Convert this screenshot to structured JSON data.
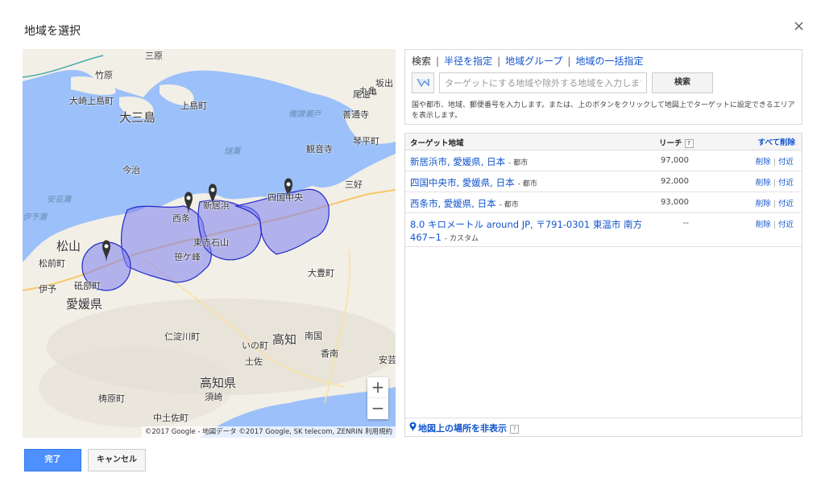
{
  "dialog": {
    "title": "地域を選択",
    "close": "×"
  },
  "tabs": {
    "search": "検索",
    "radius": "半径を指定",
    "group": "地域グループ",
    "bulk": "地域の一括指定"
  },
  "search": {
    "placeholder": "ターゲットにする地域や除外する地域を入力します",
    "button": "検索",
    "hint": "国や都市、地域、郵便番号を入力します。または、上のボタンをクリックして地図上でターゲットに設定できるエリアを表示します。"
  },
  "list": {
    "col_location": "ターゲット地域",
    "col_reach": "リーチ",
    "help": "?",
    "remove_all": "すべて削除",
    "rows": [
      {
        "name": "新居浜市, 愛媛県, 日本",
        "kind": "- 都市",
        "reach": "97,000",
        "remove": "削除",
        "nearby": "付近"
      },
      {
        "name": "四国中央市, 愛媛県, 日本",
        "kind": "- 都市",
        "reach": "92,000",
        "remove": "削除",
        "nearby": "付近"
      },
      {
        "name": "西条市, 愛媛県, 日本",
        "kind": "- 都市",
        "reach": "93,000",
        "remove": "削除",
        "nearby": "付近"
      },
      {
        "name": "8.0 キロメートル around JP, 〒791-0301 東温市 南方 467−1",
        "kind": "- カスタム",
        "reach": "--",
        "remove": "削除",
        "nearby": "付近"
      }
    ],
    "hide_locations": "地図上の場所を非表示"
  },
  "map": {
    "labels": {
      "sanhara": "三原",
      "takehara": "竹原",
      "onomichi": "尾道",
      "osakishimo": "大崎上島町",
      "kamijima": "上島町",
      "daisanto": "大三島",
      "maruka": "丸亀",
      "sakaide": "坂出",
      "zentsuji": "善通寺",
      "kotohira": "琴平町",
      "kanonji": "観音寺",
      "miyoshi": "三好",
      "imabari": "今治",
      "saijo": "西条",
      "niihama": "新居浜",
      "shikokuchuo": "四国中央",
      "toyo_ishiyama": "東赤石山",
      "kasagamine": "笹ケ峰",
      "matsuyama": "松山",
      "matsumae": "松前町",
      "iyo": "伊予",
      "tobe": "砥部町",
      "ehime": "愛媛県",
      "otoyo": "大豊町",
      "niyodogawa": "仁淀川町",
      "ino": "いの町",
      "kochi_city": "高知",
      "nankoku": "南国",
      "kami": "香南",
      "aki": "安芸",
      "tosa": "土佐",
      "kochi": "高知県",
      "susaki": "須崎",
      "yusuhara": "梼原町",
      "nakatosa": "中土佐町",
      "bingo_nada": "備讃瀬戸",
      "hiuchi_nada": "燧灘",
      "aki_nada": "安芸灘",
      "iyo_nada": "伊予灘"
    },
    "shields": [
      "2",
      "32",
      "11",
      "33",
      "32",
      "56",
      "11",
      "33"
    ],
    "zoom_in": "+",
    "zoom_out": "−",
    "attribution": "©2017 Google - 地図データ ©2017 Google, SK telecom, ZENRIN   利用規約",
    "colors": {
      "water": "#9cc0f9",
      "land": "#f2efe6",
      "region": "#7b7ef0",
      "region_stroke": "#2329c9"
    }
  },
  "footer": {
    "done": "完了",
    "cancel": "キャンセル"
  }
}
